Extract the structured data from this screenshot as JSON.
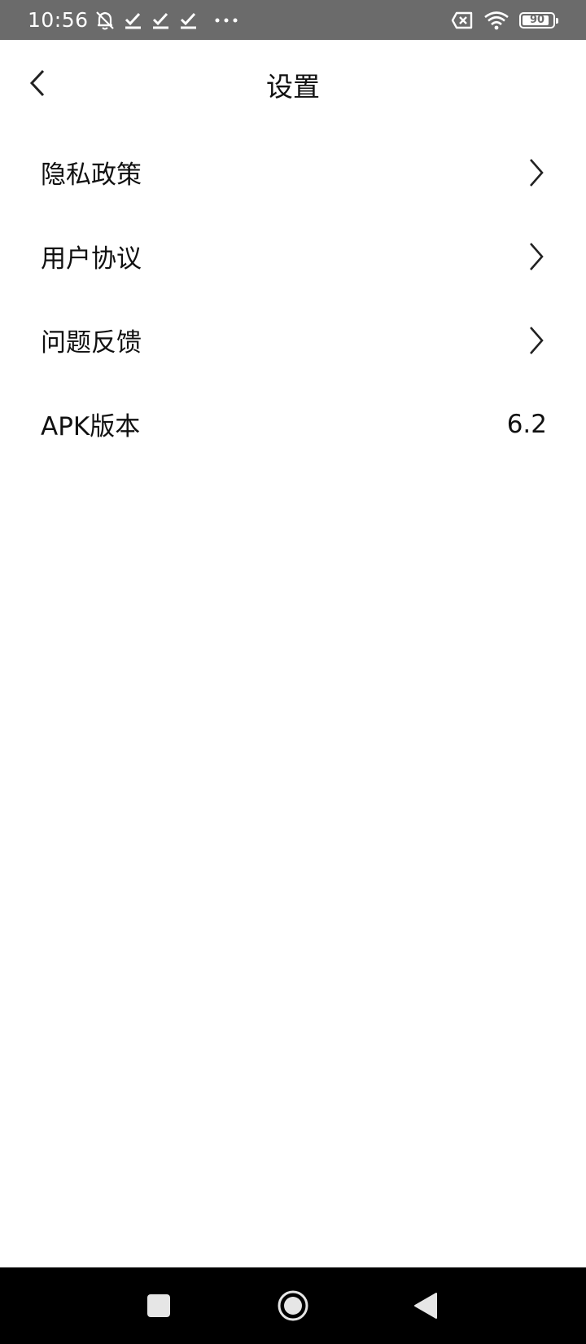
{
  "status_bar": {
    "time": "10:56",
    "icons": [
      "muted-bell-icon",
      "check-icon",
      "check-icon",
      "check-icon",
      "more-dots-icon"
    ],
    "battery_level": 90,
    "battery_label": "90",
    "right_icons": [
      "sim-x-icon",
      "wifi-icon",
      "battery-icon"
    ]
  },
  "header": {
    "title": "设置",
    "back_icon": "chevron-left-icon"
  },
  "settings": {
    "items": [
      {
        "label": "隐私政策",
        "icon": "chevron-right-icon"
      },
      {
        "label": "用户协议",
        "icon": "chevron-right-icon"
      },
      {
        "label": "问题反馈",
        "icon": "chevron-right-icon"
      },
      {
        "label": "APK版本",
        "value": "6.2"
      }
    ]
  },
  "nav_bar": {
    "buttons": [
      "recents-square-icon",
      "home-circle-icon",
      "back-triangle-icon"
    ]
  }
}
